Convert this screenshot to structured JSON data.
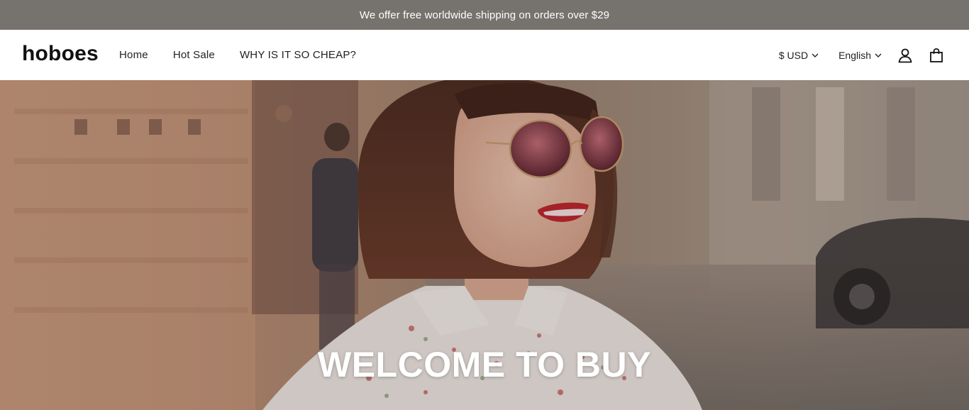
{
  "announcement": {
    "text": "We offer free worldwide shipping on orders over $29"
  },
  "header": {
    "logo": "hoboes",
    "nav": [
      {
        "label": "Home"
      },
      {
        "label": "Hot Sale"
      },
      {
        "label": "WHY IS IT SO CHEAP?"
      }
    ],
    "currency": "$ USD",
    "language": "English",
    "icons": {
      "account": "user-icon",
      "cart": "shopping-bag-icon",
      "dropdown": "chevron-down-icon"
    }
  },
  "hero": {
    "title": "WELCOME TO BUY",
    "image": "woman-with-sunglasses-street-photo"
  },
  "colors": {
    "announcement_bg": "#76726d",
    "header_bg": "#ffffff",
    "text": "#111111",
    "hero_title": "#ffffff"
  }
}
